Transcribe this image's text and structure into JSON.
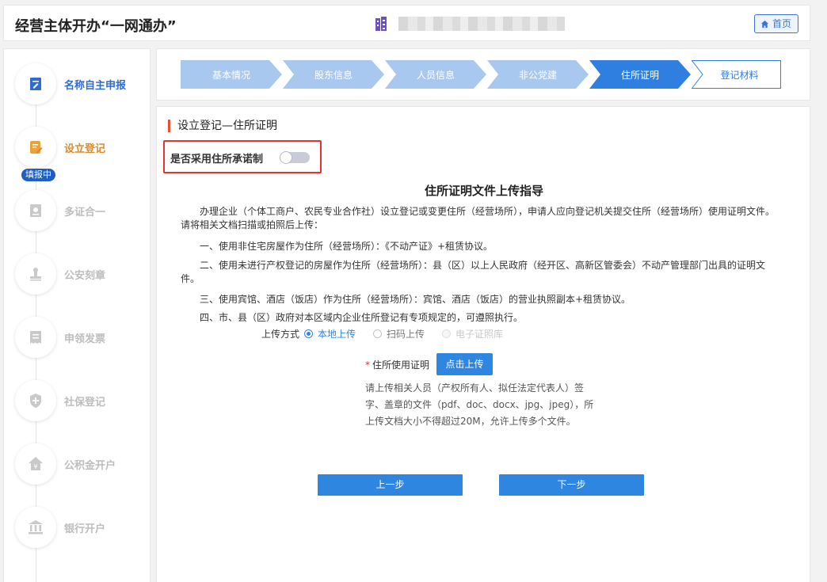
{
  "header": {
    "app_title": "经营主体开办“一网通办”",
    "home_label": "首页"
  },
  "sidebar": {
    "filling_badge": "填报中",
    "items": [
      {
        "label": "名称自主申报",
        "icon": "document-edit-icon"
      },
      {
        "label": "设立登记",
        "icon": "form-edit-icon"
      },
      {
        "label": "多证合一",
        "icon": "certificate-icon"
      },
      {
        "label": "公安刻章",
        "icon": "stamp-icon"
      },
      {
        "label": "申领发票",
        "icon": "invoice-icon"
      },
      {
        "label": "社保登记",
        "icon": "shield-icon"
      },
      {
        "label": "公积金开户",
        "icon": "house-yuan-icon"
      },
      {
        "label": "银行开户",
        "icon": "bank-icon"
      }
    ]
  },
  "steps": [
    {
      "label": "基本情况",
      "state": "done"
    },
    {
      "label": "股东信息",
      "state": "done"
    },
    {
      "label": "人员信息",
      "state": "done"
    },
    {
      "label": "非公党建",
      "state": "done"
    },
    {
      "label": "住所证明",
      "state": "current"
    },
    {
      "label": "登记材料",
      "state": "todo"
    }
  ],
  "content": {
    "section_title": "设立登记—住所证明",
    "promise_label": "是否采用住所承诺制",
    "promise_enabled": false,
    "guide_title": "住所证明文件上传指导",
    "guide_intro": "办理企业（个体工商户、农民专业合作社）设立登记或变更住所（经营场所），申请人应向登记机关提交住所（经营场所）使用证明文件。请将相关文档扫描或拍照后上传：",
    "guide_items": [
      "一、使用非住宅房屋作为住所（经营场所）：《不动产证》+租赁协议。",
      "二、使用未进行产权登记的房屋作为住所（经营场所）：县（区）以上人民政府（经开区、高新区管委会）不动产管理部门出具的证明文件。",
      "三、使用宾馆、酒店（饭店）作为住所（经营场所）：宾馆、酒店（饭店）的营业执照副本+租赁协议。",
      "四、市、县（区）政府对本区域内企业住所登记有专项规定的，可遵照执行。"
    ],
    "upload_method_label": "上传方式",
    "upload_methods": [
      {
        "label": "本地上传",
        "state": "checked"
      },
      {
        "label": "扫码上传",
        "state": "unchecked"
      },
      {
        "label": "电子证照库",
        "state": "disabled"
      }
    ],
    "cert_required_mark": "*",
    "cert_label": "住所使用证明",
    "upload_button": "点击上传",
    "upload_hint_lines": [
      "请上传相关人员（产权所有人、拟任法定代表人）签",
      "字、盖章的文件（pdf、doc、docx、jpg、jpeg），所",
      "上传文档大小不得超过20M，允许上传多个文件。"
    ],
    "prev_button": "上一步",
    "next_button": "下一步"
  },
  "colors": {
    "primary": "#2f86e0",
    "step_done": "#a9c8f0",
    "step_current": "#2f7fe0",
    "accent_orange": "#e0892a",
    "highlight_red": "#e53232"
  }
}
